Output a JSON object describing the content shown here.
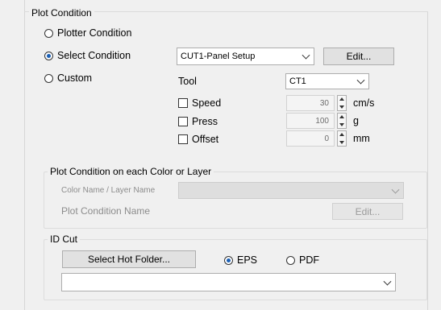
{
  "plot_condition": {
    "legend": "Plot Condition",
    "radios": [
      {
        "label": "Plotter Condition",
        "checked": false
      },
      {
        "label": "Select Condition",
        "checked": true
      },
      {
        "label": "Custom",
        "checked": false
      }
    ],
    "condition_select": {
      "value": "CUT1-Panel Setup"
    },
    "edit_button": "Edit...",
    "tool_label": "Tool",
    "tool_select": {
      "value": "CT1"
    },
    "params": [
      {
        "label": "Speed",
        "value": "30",
        "unit": "cm/s",
        "checked": false
      },
      {
        "label": "Press",
        "value": "100",
        "unit": "g",
        "checked": false
      },
      {
        "label": "Offset",
        "value": "0",
        "unit": "mm",
        "checked": false
      }
    ]
  },
  "color_layer": {
    "legend": "Plot Condition on each Color or Layer",
    "name_label": "Color Name / Layer Name",
    "name_select": {
      "value": ""
    },
    "condition_label": "Plot Condition Name",
    "edit_button": "Edit..."
  },
  "id_cut": {
    "legend": "ID Cut",
    "select_folder_button": "Select Hot Folder...",
    "formats": [
      {
        "label": "EPS",
        "checked": true
      },
      {
        "label": "PDF",
        "checked": false
      }
    ],
    "folder_select": {
      "value": ""
    }
  }
}
